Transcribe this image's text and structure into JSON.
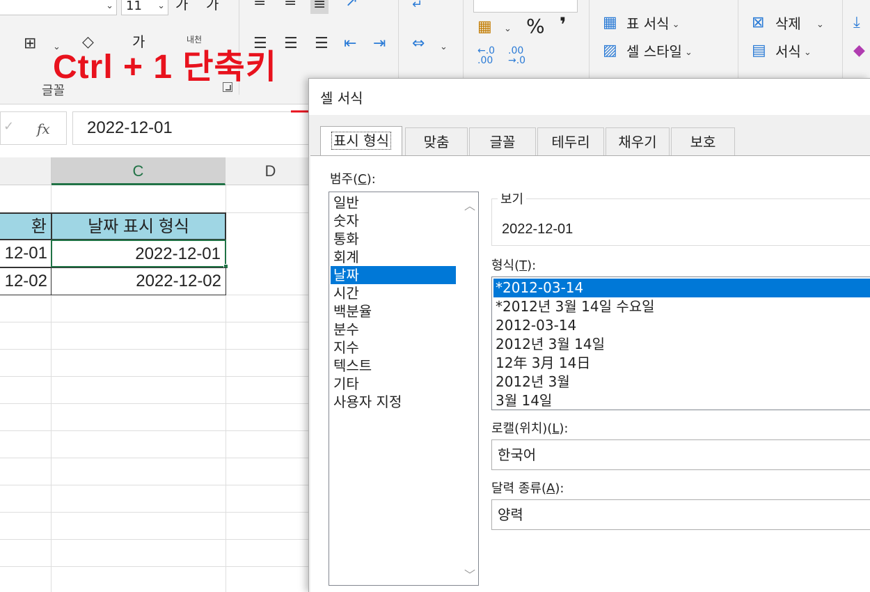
{
  "ribbon": {
    "font_size": "11",
    "font_group_label": "글꼴",
    "wrap_text_label": "내천",
    "percent_symbol": "%",
    "comma_symbol": "❜",
    "table_format_label": "표 서식",
    "cell_style_label": "셀 스타일",
    "delete_label": "삭제",
    "format_label": "서식",
    "font_grow_label": "가",
    "font_shrink_label": "가",
    "font_color_label": "가"
  },
  "overlay": {
    "shortcut_text": "Ctrl + 1 단축키",
    "color": "#e8121d"
  },
  "formula_bar": {
    "fx_label": "fx",
    "value": "2022-12-01"
  },
  "sheet": {
    "columns": [
      "C",
      "D"
    ],
    "selected_column": "C",
    "header_left_partial": "환",
    "header_c": "날짜 표시 형식",
    "rows": [
      {
        "left": "12-01",
        "c": "2022-12-01"
      },
      {
        "left": "12-02",
        "c": "2022-12-02"
      }
    ],
    "header_fill": "#9fd6e4",
    "accent": "#217346"
  },
  "dialog": {
    "title": "셀 서식",
    "tabs": [
      {
        "label": "표시 형식",
        "active": true
      },
      {
        "label": "맞춤",
        "active": false
      },
      {
        "label": "글꼴",
        "active": false
      },
      {
        "label": "테두리",
        "active": false
      },
      {
        "label": "채우기",
        "active": false
      },
      {
        "label": "보호",
        "active": false
      }
    ],
    "category_label_text": "범주(",
    "category_label_key": "C",
    "category_label_end": "):",
    "categories": [
      "일반",
      "숫자",
      "통화",
      "회계",
      "날짜",
      "시간",
      "백분율",
      "분수",
      "지수",
      "텍스트",
      "기타",
      "사용자 지정"
    ],
    "selected_category": "날짜",
    "preview_label": "보기",
    "preview_value": "2022-12-01",
    "format_label_text": "형식(",
    "format_label_key": "T",
    "format_label_end": "):",
    "formats": [
      "*2012-03-14",
      "*2012년 3월 14일 수요일",
      "2012-03-14",
      "2012년 3월 14일",
      "12年 3月 14日",
      "2012년 3월",
      "3월 14일"
    ],
    "selected_format": "*2012-03-14",
    "locale_label_text": "로캘(위치)(",
    "locale_label_key": "L",
    "locale_label_end": "):",
    "locale_value": "한국어",
    "calendar_label_text": "달력 종류(",
    "calendar_label_key": "A",
    "calendar_label_end": "):",
    "calendar_value": "양력",
    "selection_color": "#0078d7"
  }
}
